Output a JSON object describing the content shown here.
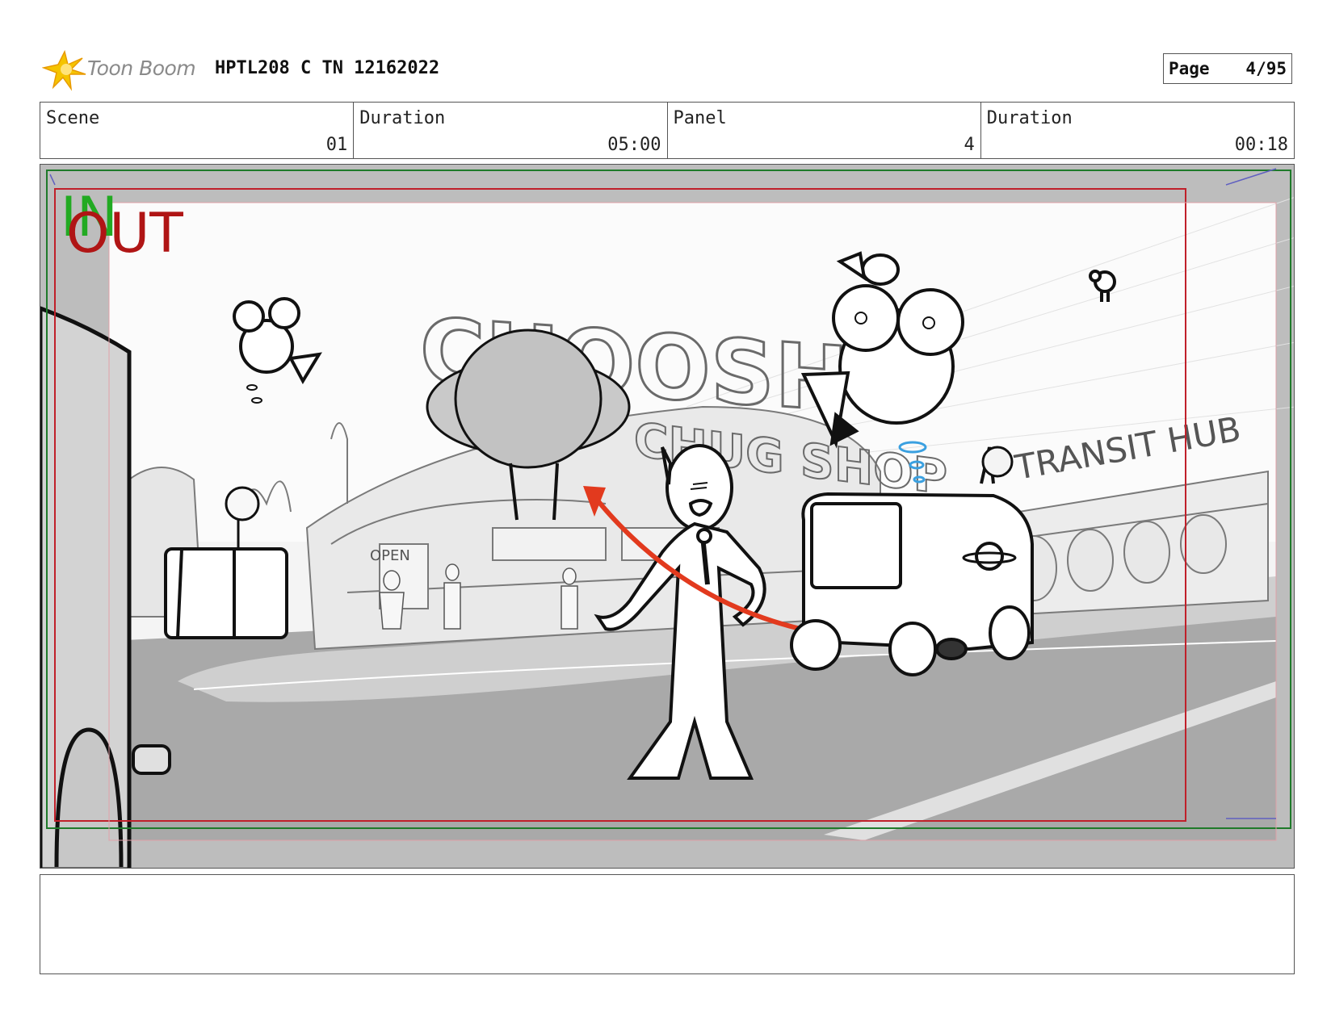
{
  "header": {
    "logo_text": "Toon Boom",
    "doc_title": "HPTL208 C TN 12162022",
    "page_label": "Page",
    "page_value": "4/95"
  },
  "info": [
    {
      "label": "Scene",
      "value": "01"
    },
    {
      "label": "Duration",
      "value": "05:00"
    },
    {
      "label": "Panel",
      "value": "4"
    },
    {
      "label": "Duration",
      "value": "00:18"
    }
  ],
  "panel": {
    "in_label": "IN",
    "out_label": "OUT",
    "sign_main": "CHOOSH'S",
    "sign_sub": "CHUG SHOP",
    "sign_transit": "TRANSIT HUB",
    "sign_open": "OPEN",
    "colors": {
      "in_green": "#22aa22",
      "out_red": "#b01515",
      "arrow_red": "#e23a1e",
      "bubble_blue": "#3aa0e0",
      "frame_green": "#1f7a2a",
      "frame_red": "#c0202a"
    }
  },
  "notes": {
    "text": ""
  }
}
